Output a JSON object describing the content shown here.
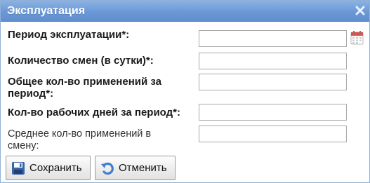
{
  "dialog": {
    "title": "Эксплуатация"
  },
  "form": {
    "fields": [
      {
        "label_line1": "Период эксплуатации*:",
        "label_line2": "",
        "value": ""
      },
      {
        "label_line1": "Количество смен (в сутки)*:",
        "label_line2": "",
        "value": ""
      },
      {
        "label_line1": "Общее кол-во применений за",
        "label_line2": "период*:",
        "value": ""
      },
      {
        "label_line1": "Кол-во рабочих дней за период*:",
        "label_line2": "",
        "value": ""
      },
      {
        "label_line1": "Среднее кол-во применений в",
        "label_line2": "смену:",
        "value": ""
      }
    ]
  },
  "buttons": {
    "save_label": "Сохранить",
    "cancel_label": "Отменить"
  },
  "icons": {
    "close": "close-icon",
    "calendar": "calendar-icon",
    "save": "floppy-disk-icon",
    "cancel": "undo-icon"
  },
  "colors": {
    "titlebar": "#6b98d6",
    "title_text": "#ffffff",
    "save_icon": "#3a63a8",
    "cancel_icon": "#3f7fd0",
    "calendar_accent": "#d9534f"
  }
}
